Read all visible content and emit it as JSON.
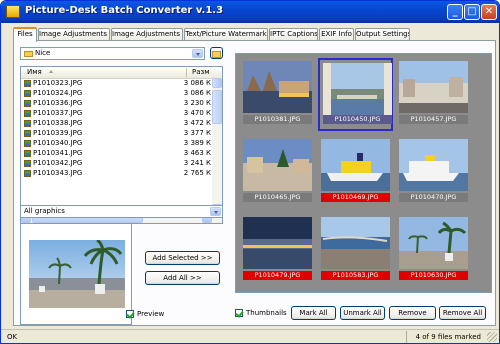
{
  "window": {
    "title": "Picture-Desk Batch Converter v.1.3"
  },
  "tabs": [
    {
      "label": "Files",
      "active": true
    },
    {
      "label": "Image Adjustments 1",
      "active": false
    },
    {
      "label": "Image Adjustments 2",
      "active": false
    },
    {
      "label": "Text/Picture Watermark",
      "active": false
    },
    {
      "label": "IPTC Captions",
      "active": false
    },
    {
      "label": "EXIF Info",
      "active": false
    },
    {
      "label": "Output Settings",
      "active": false
    }
  ],
  "folder_combo": {
    "value": "Nice"
  },
  "file_list": {
    "columns": [
      "Имя",
      "Разм"
    ],
    "rows": [
      {
        "name": "P1010323.JPG",
        "size": "3 086 К"
      },
      {
        "name": "P1010324.JPG",
        "size": "3 086 К"
      },
      {
        "name": "P1010336.JPG",
        "size": "3 230 К"
      },
      {
        "name": "P1010337.JPG",
        "size": "3 470 К"
      },
      {
        "name": "P1010338.JPG",
        "size": "3 472 К"
      },
      {
        "name": "P1010339.JPG",
        "size": "3 377 К"
      },
      {
        "name": "P1010340.JPG",
        "size": "3 389 К"
      },
      {
        "name": "P1010341.JPG",
        "size": "3 463 К"
      },
      {
        "name": "P1010342.JPG",
        "size": "3 241 К"
      },
      {
        "name": "P1010343.JPG",
        "size": "2 765 К"
      }
    ]
  },
  "filter_combo": {
    "value": "All graphics"
  },
  "buttons": {
    "add_selected": "Add Selected >>",
    "add_all": "Add All >>",
    "mark_all": "Mark All",
    "unmark_all": "Unmark All",
    "remove": "Remove",
    "remove_all": "Remove All"
  },
  "checkboxes": {
    "preview": {
      "label": "Preview",
      "checked": true
    },
    "thumbnails": {
      "label": "Thumbnails",
      "checked": true
    }
  },
  "thumbnails": [
    {
      "name": "P1010381.JPG",
      "marked": false,
      "selected": false,
      "scene": "harbor-dusk"
    },
    {
      "name": "P1010450.JPG",
      "marked": false,
      "selected": true,
      "scene": "bay-day"
    },
    {
      "name": "P1010457.JPG",
      "marked": false,
      "selected": false,
      "scene": "cityscape"
    },
    {
      "name": "P1010465.JPG",
      "marked": false,
      "selected": false,
      "scene": "street-xmas"
    },
    {
      "name": "P1010469.JPG",
      "marked": true,
      "selected": false,
      "scene": "ferry"
    },
    {
      "name": "P1010470.JPG",
      "marked": false,
      "selected": false,
      "scene": "ferry2"
    },
    {
      "name": "P1010479.JPG",
      "marked": true,
      "selected": false,
      "scene": "night-promenade"
    },
    {
      "name": "P1010583.JPG",
      "marked": true,
      "selected": false,
      "scene": "beach"
    },
    {
      "name": "P1010630.JPG",
      "marked": true,
      "selected": false,
      "scene": "palms"
    }
  ],
  "status": {
    "left": "OK",
    "right": "4 of 9 files marked"
  },
  "colors": {
    "marked": "#e00000",
    "titlebar": "#0a58e5",
    "selection": "#2b2bc7"
  }
}
